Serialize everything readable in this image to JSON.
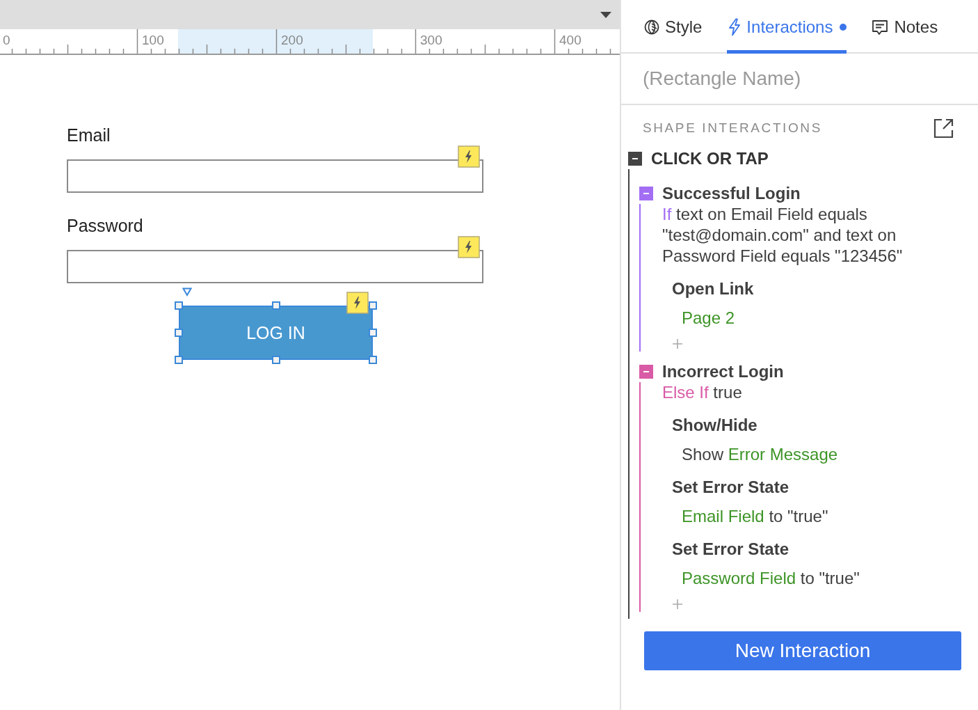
{
  "canvas": {
    "ruler": {
      "labels": [
        "0",
        "100",
        "200",
        "300",
        "400"
      ]
    },
    "fields": [
      {
        "label": "Email",
        "interaction": true
      },
      {
        "label": "Password",
        "interaction": true
      }
    ],
    "button": {
      "label": "LOG IN",
      "selected": true,
      "interaction": true
    }
  },
  "panel": {
    "tabs": [
      {
        "label": "Style",
        "selected": false,
        "indicator": false
      },
      {
        "label": "Interactions",
        "selected": true,
        "indicator": true
      },
      {
        "label": "Notes",
        "selected": false,
        "indicator": false
      }
    ],
    "name_field": {
      "placeholder": "(Rectangle Name)"
    },
    "section_title": "SHAPE INTERACTIONS",
    "event": {
      "title": "CLICK OR TAP",
      "expanded": true,
      "cases": [
        {
          "title": "Successful Login",
          "color": "#a36ef4",
          "expanded": true,
          "keyword": "If",
          "condition": "text on Email Field equals \"test@domain.com\" and text on Password Field equals \"123456\"",
          "actions": [
            {
              "title": "Open Link",
              "detail": [
                {
                  "kind": "target",
                  "text": "Page 2"
                }
              ]
            }
          ]
        },
        {
          "title": "Incorrect Login",
          "color": "#d95ba6",
          "expanded": true,
          "keyword": "Else If",
          "condition": "true",
          "actions": [
            {
              "title": "Show/Hide",
              "detail": [
                {
                  "kind": "plain",
                  "text": "Show"
                },
                {
                  "kind": "target",
                  "text": "Error Message"
                }
              ]
            },
            {
              "title": "Set Error State",
              "detail": [
                {
                  "kind": "target",
                  "text": "Email Field"
                },
                {
                  "kind": "plain",
                  "text": "to \"true\""
                }
              ]
            },
            {
              "title": "Set Error State",
              "detail": [
                {
                  "kind": "target",
                  "text": "Password Field"
                },
                {
                  "kind": "plain",
                  "text": "to \"true\""
                }
              ]
            }
          ]
        }
      ]
    },
    "new_button": "New Interaction"
  }
}
